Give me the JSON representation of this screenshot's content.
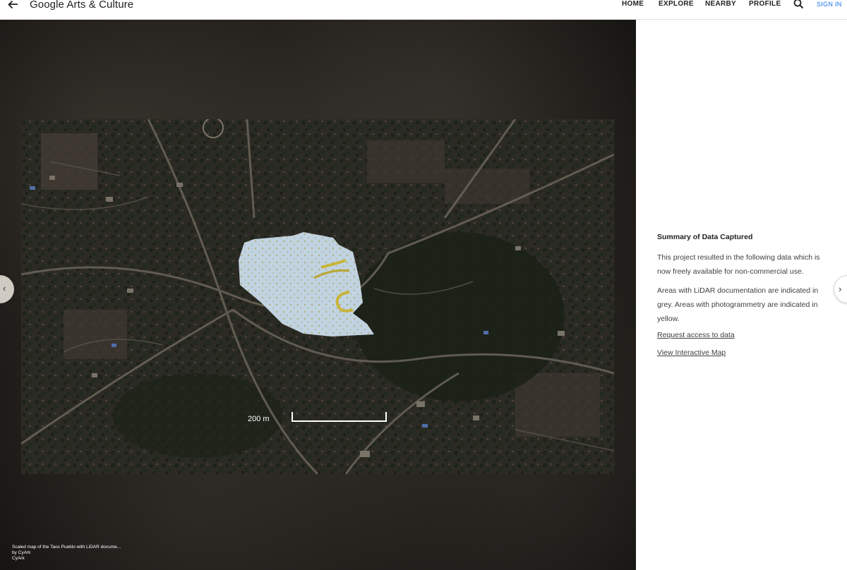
{
  "header": {
    "back_icon": "arrow-left-icon",
    "brand": "Google Arts & Culture",
    "nav": {
      "home": "HOME",
      "explore": "EXPLORE",
      "nearby": "NEARBY",
      "profile": "PROFILE"
    },
    "search_icon": "search-icon",
    "sign_in": "SIGN IN"
  },
  "viewer": {
    "scale_label": "200 m",
    "caption": {
      "title": "Scaled map of the Taos Pueblo with LiDAR docume...",
      "by": "by CyArk",
      "owner": "CyArk"
    },
    "prev_icon": "chevron-left-icon",
    "next_icon": "chevron-right-icon"
  },
  "panel": {
    "title": "Summary of Data Captured",
    "para1": "This project resulted in the following data which is now freely available for non-commercial use.",
    "para2": "Areas with LiDAR documentation are indicated in grey. Areas with photogrammetry are indicated in yellow.",
    "link_request": "Request access to data",
    "link_map": "View Interactive Map"
  },
  "colors": {
    "accent": "#1a73e8",
    "lidar_area": "#c9dcec",
    "photogrammetry": "#c8b43a"
  }
}
